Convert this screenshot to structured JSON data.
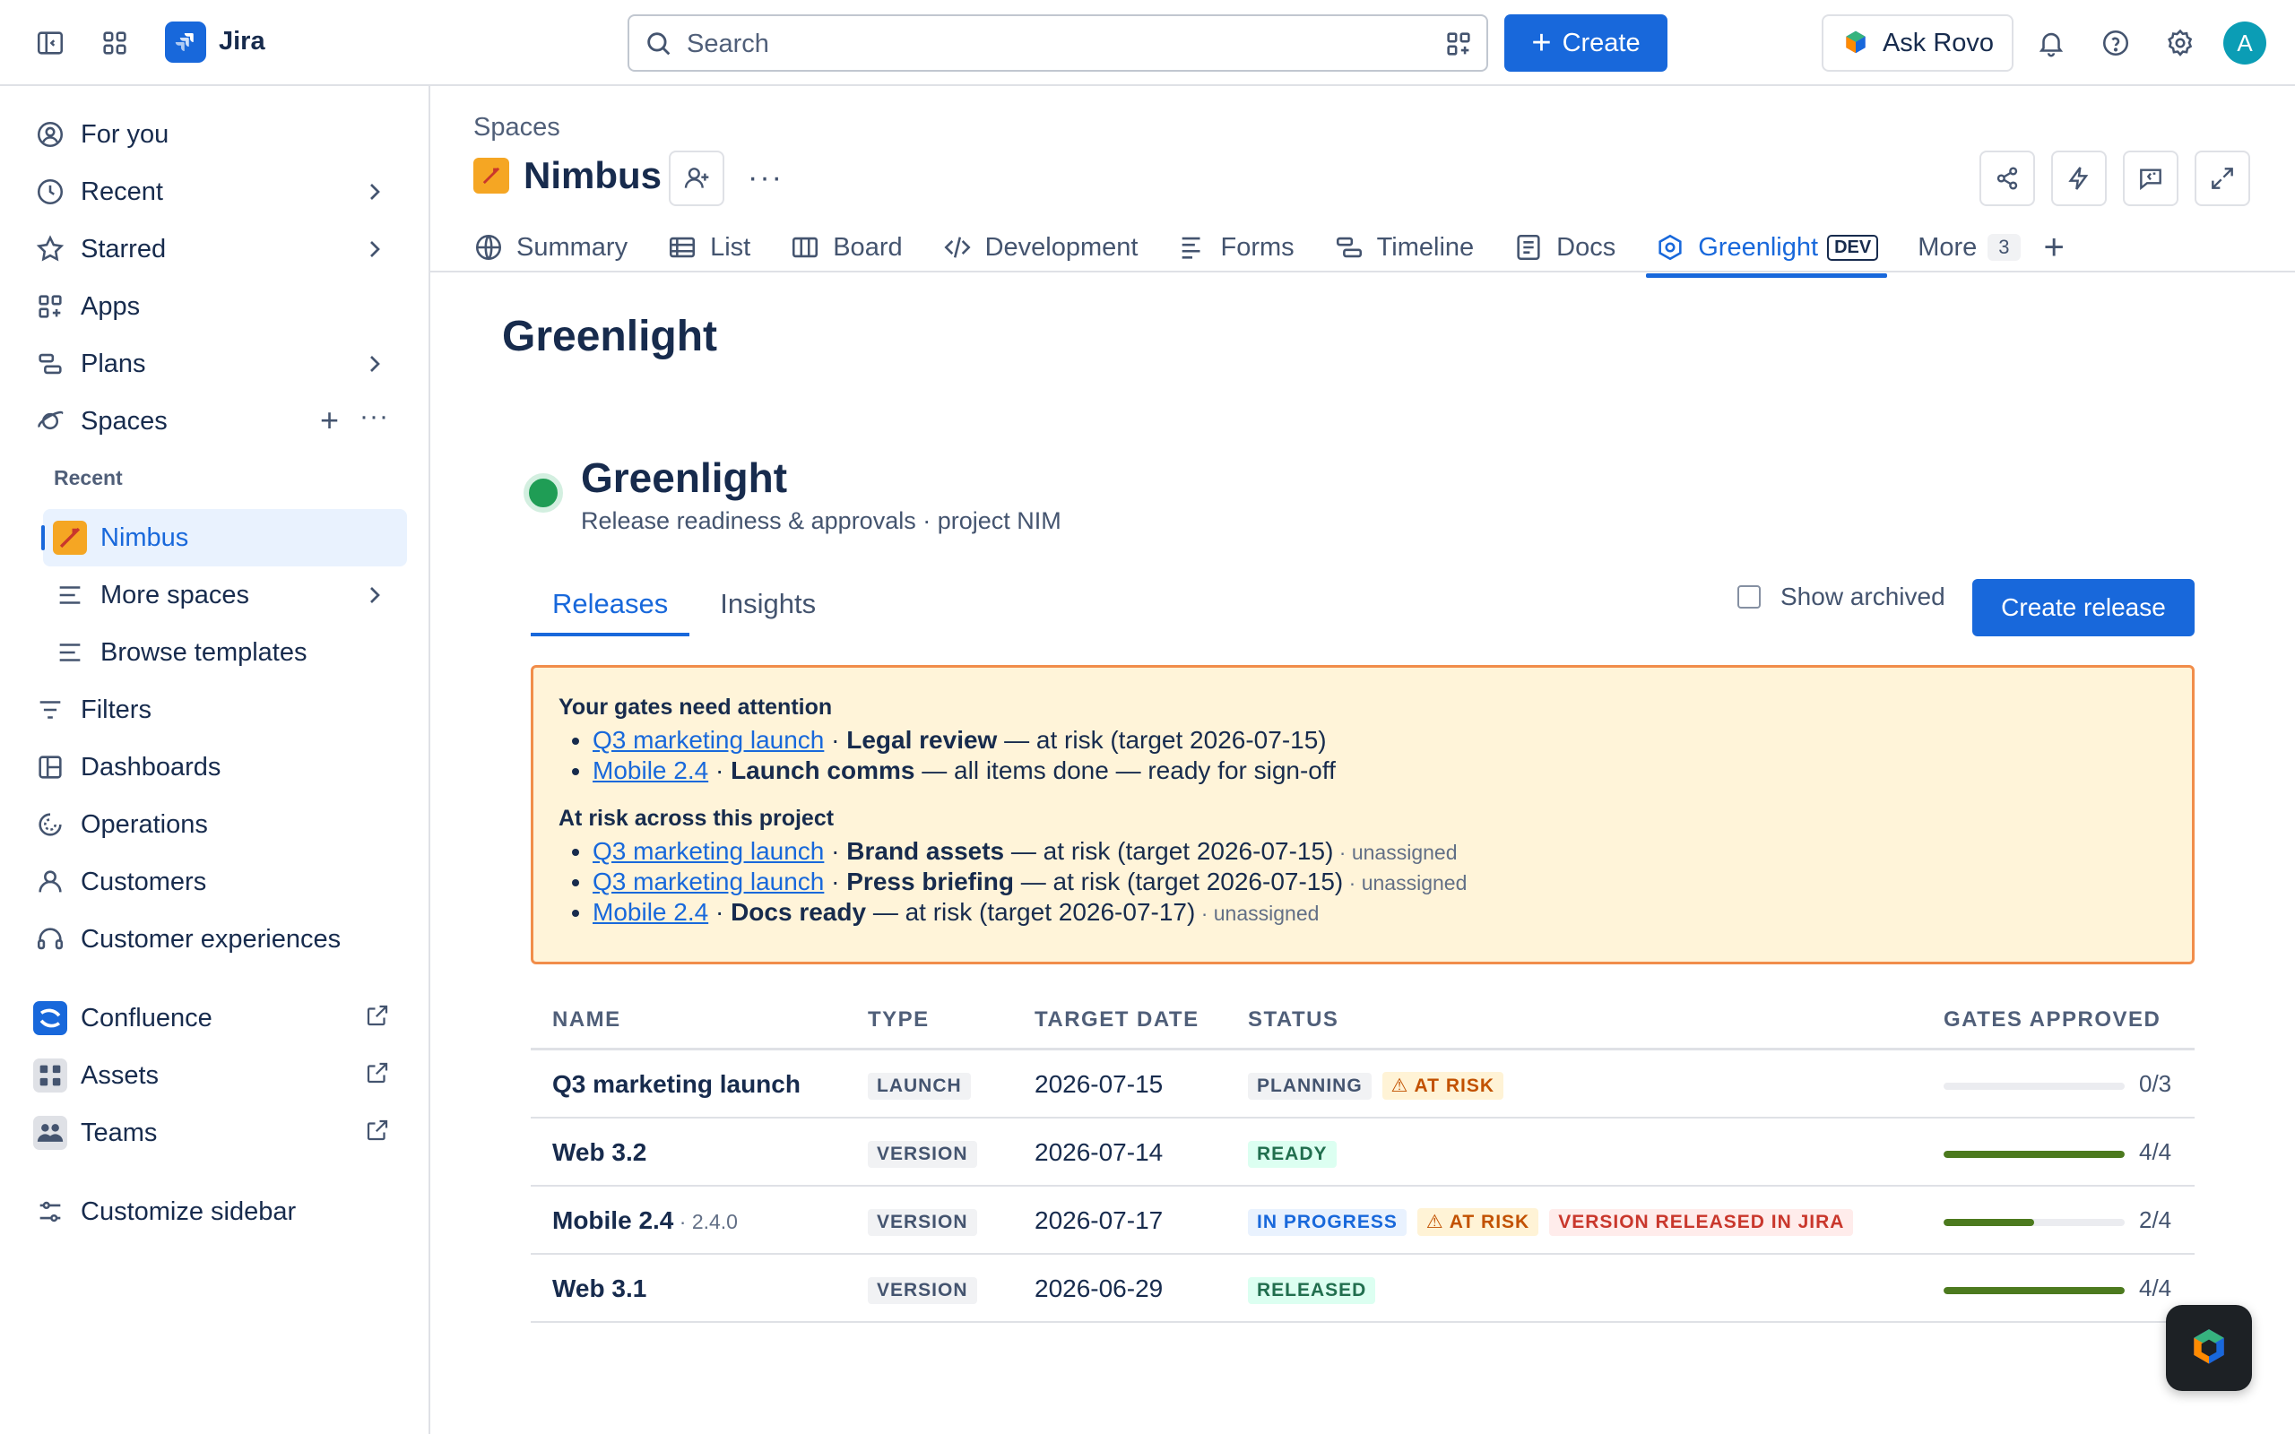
{
  "topbar": {
    "app_name": "Jira",
    "search_placeholder": "Search",
    "create_label": "Create",
    "rovo_label": "Ask Rovo",
    "avatar_initial": "A"
  },
  "sidebar": {
    "items": [
      {
        "label": "For you",
        "icon": "person-circle-icon"
      },
      {
        "label": "Recent",
        "icon": "clock-icon"
      },
      {
        "label": "Starred",
        "icon": "star-icon"
      },
      {
        "label": "Apps",
        "icon": "apps-grid-icon"
      },
      {
        "label": "Plans",
        "icon": "plans-icon"
      },
      {
        "label": "Spaces",
        "icon": "planet-icon"
      }
    ],
    "recent_heading": "Recent",
    "active_space": "Nimbus",
    "more_spaces": "More spaces",
    "browse_templates": "Browse templates",
    "lower_items": [
      {
        "label": "Filters",
        "icon": "filter-icon"
      },
      {
        "label": "Dashboards",
        "icon": "dashboard-icon"
      },
      {
        "label": "Operations",
        "icon": "operations-icon"
      },
      {
        "label": "Customers",
        "icon": "person-icon"
      },
      {
        "label": "Customer experiences",
        "icon": "headset-icon"
      }
    ],
    "apps": [
      {
        "label": "Confluence",
        "icon": "confluence-icon"
      },
      {
        "label": "Assets",
        "icon": "assets-icon"
      },
      {
        "label": "Teams",
        "icon": "teams-icon"
      }
    ],
    "customize": "Customize sidebar"
  },
  "space": {
    "breadcrumb": "Spaces",
    "name": "Nimbus",
    "tabs": [
      {
        "label": "Summary",
        "icon": "globe-icon"
      },
      {
        "label": "List",
        "icon": "list-icon"
      },
      {
        "label": "Board",
        "icon": "board-icon"
      },
      {
        "label": "Development",
        "icon": "code-icon"
      },
      {
        "label": "Forms",
        "icon": "forms-icon"
      },
      {
        "label": "Timeline",
        "icon": "timeline-icon"
      },
      {
        "label": "Docs",
        "icon": "docs-icon"
      },
      {
        "label": "Greenlight",
        "icon": "greenlight-icon",
        "badge": "DEV"
      },
      {
        "label": "More",
        "count": "3"
      }
    ]
  },
  "page": {
    "heading": "Greenlight",
    "app_title": "Greenlight",
    "app_subtitle": "Release readiness & approvals · project NIM",
    "tabs": [
      "Releases",
      "Insights"
    ],
    "show_archived": "Show archived",
    "create_release": "Create release"
  },
  "alert": {
    "heading1": "Your gates need attention",
    "mine": [
      {
        "release": "Q3 marketing launch",
        "gate": "Legal review",
        "detail": " — at risk (target 2026-07-15)"
      },
      {
        "release": "Mobile 2.4",
        "gate": "Launch comms",
        "detail": " — all items done — ready for sign-off"
      }
    ],
    "heading2": "At risk across this project",
    "project": [
      {
        "release": "Q3 marketing launch",
        "gate": "Brand assets",
        "detail": " — at risk (target 2026-07-15)",
        "note": " · unassigned"
      },
      {
        "release": "Q3 marketing launch",
        "gate": "Press briefing",
        "detail": " — at risk (target 2026-07-15)",
        "note": " · unassigned"
      },
      {
        "release": "Mobile 2.4",
        "gate": "Docs ready",
        "detail": " — at risk (target 2026-07-17)",
        "note": " · unassigned"
      }
    ]
  },
  "table": {
    "headers": {
      "name": "NAME",
      "type": "TYPE",
      "target": "TARGET DATE",
      "status": "STATUS",
      "gates": "GATES APPROVED"
    },
    "rows": [
      {
        "name": "Q3 marketing launch",
        "version": "",
        "type": "LAUNCH",
        "target": "2026-07-15",
        "statuses": [
          {
            "label": "PLANNING",
            "tone": "grey"
          },
          {
            "label": "⚠ AT RISK",
            "tone": "orange"
          }
        ],
        "gates": "0/3",
        "progress": 0
      },
      {
        "name": "Web 3.2",
        "version": "",
        "type": "VERSION",
        "target": "2026-07-14",
        "statuses": [
          {
            "label": "READY",
            "tone": "green"
          }
        ],
        "gates": "4/4",
        "progress": 1
      },
      {
        "name": "Mobile 2.4",
        "version": " · 2.4.0",
        "type": "VERSION",
        "target": "2026-07-17",
        "statuses": [
          {
            "label": "IN PROGRESS",
            "tone": "blue"
          },
          {
            "label": "⚠ AT RISK",
            "tone": "orange"
          },
          {
            "label": "VERSION RELEASED IN JIRA",
            "tone": "red"
          }
        ],
        "gates": "2/4",
        "progress": 0.5
      },
      {
        "name": "Web 3.1",
        "version": "",
        "type": "VERSION",
        "target": "2026-06-29",
        "statuses": [
          {
            "label": "RELEASED",
            "tone": "green"
          }
        ],
        "gates": "4/4",
        "progress": 1
      }
    ]
  },
  "colors": {
    "brand": "#1868db",
    "status_green": "#1f9d55",
    "alert_bg": "#fff4d9",
    "alert_border": "#f18d4a",
    "progress": "#4c7a1e"
  }
}
